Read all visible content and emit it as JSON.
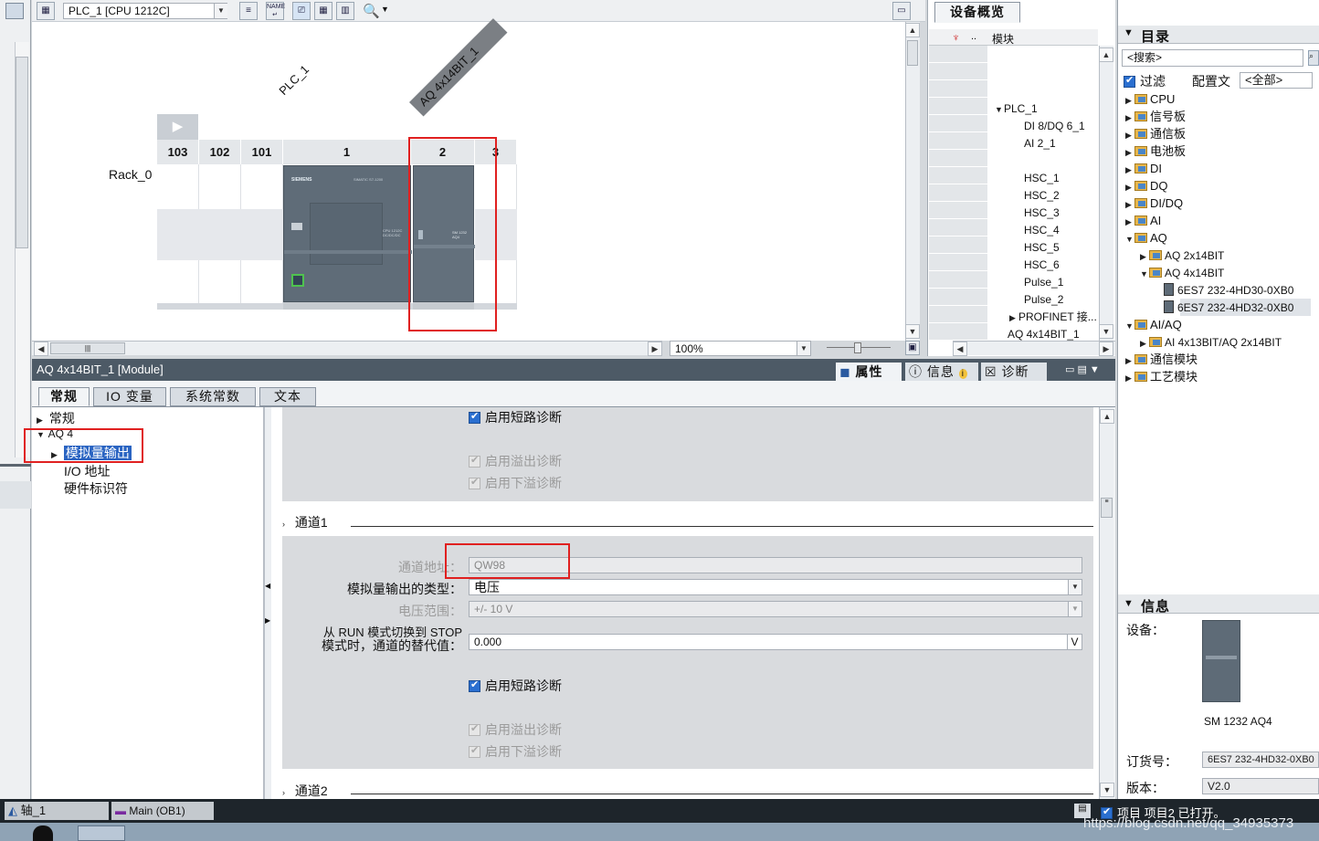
{
  "toolbar": {
    "device_select": "PLC_1 [CPU 1212C]",
    "zoom": "100%"
  },
  "canvas": {
    "plc_label": "PLC_1",
    "module_label": "AQ 4x14BIT_1",
    "rack_label": "Rack_0",
    "slots": [
      "103",
      "102",
      "101",
      "1",
      "2",
      "3"
    ],
    "cpu_brand": "SIEMENS",
    "cpu_model": "SIMATIC S7-1200",
    "cpu_text": "CPU 1212C DC/DC/DC",
    "module_text": "SM 1232 AQ4"
  },
  "overview": {
    "tab": "设备概览",
    "col_module": "模块",
    "rows": [
      "PLC_1",
      "DI 8/DQ 6_1",
      "AI 2_1",
      "HSC_1",
      "HSC_2",
      "HSC_3",
      "HSC_4",
      "HSC_5",
      "HSC_6",
      "Pulse_1",
      "Pulse_2",
      "PROFINET 接...",
      "AQ 4x14BIT_1"
    ]
  },
  "catalog": {
    "title": "目录",
    "search_placeholder": "<搜索>",
    "filter_label": "过滤",
    "config_label": "配置文",
    "config_value": "<全部>",
    "items": [
      {
        "label": "CPU",
        "level": 0,
        "expanded": false
      },
      {
        "label": "信号板",
        "level": 0,
        "expanded": false
      },
      {
        "label": "通信板",
        "level": 0,
        "expanded": false
      },
      {
        "label": "电池板",
        "level": 0,
        "expanded": false
      },
      {
        "label": "DI",
        "level": 0,
        "expanded": false
      },
      {
        "label": "DQ",
        "level": 0,
        "expanded": false
      },
      {
        "label": "DI/DQ",
        "level": 0,
        "expanded": false
      },
      {
        "label": "AI",
        "level": 0,
        "expanded": false
      },
      {
        "label": "AQ",
        "level": 0,
        "expanded": true
      },
      {
        "label": "AQ 2x14BIT",
        "level": 1,
        "expanded": false
      },
      {
        "label": "AQ 4x14BIT",
        "level": 1,
        "expanded": true
      },
      {
        "label": "6ES7 232-4HD30-0XB0",
        "level": 2,
        "expanded": false
      },
      {
        "label": "6ES7 232-4HD32-0XB0",
        "level": 2,
        "expanded": false
      },
      {
        "label": "AI/AQ",
        "level": 0,
        "expanded": true
      },
      {
        "label": "AI 4x13BIT/AQ 2x14BIT",
        "level": 1,
        "expanded": false
      },
      {
        "label": "通信模块",
        "level": 0,
        "expanded": false
      },
      {
        "label": "工艺模块",
        "level": 0,
        "expanded": false
      }
    ]
  },
  "info": {
    "title": "信息",
    "device_label": "设备：",
    "device_name": "SM 1232 AQ4",
    "order_label": "订货号：",
    "order_value": "6ES7 232-4HD32-0XB0",
    "version_label": "版本：",
    "version_value": "V2.0"
  },
  "properties": {
    "title": "AQ 4x14BIT_1 [Module]",
    "top_tabs": [
      "属性",
      "信息",
      "诊断"
    ],
    "tabs": [
      "常规",
      "IO 变量",
      "系统常数",
      "文本"
    ],
    "nav": [
      "常规",
      "AQ 4",
      "模拟量输出",
      "I/O 地址",
      "硬件标识符"
    ],
    "enable_short": "启用短路诊断",
    "enable_overflow": "启用溢出诊断",
    "enable_underflow": "启用下溢诊断",
    "channel1": "通道1",
    "channel2": "通道2",
    "addr_label": "通道地址：",
    "addr_value": "QW98",
    "type_label": "模拟量输出的类型：",
    "type_value": "电压",
    "range_label": "电压范围：",
    "range_value": "+/- 10 V",
    "subst_label_1": "从 RUN 模式切换到 STOP",
    "subst_label_2": "模式时，通道的替代值：",
    "subst_value": "0.000",
    "subst_unit": "V"
  },
  "statusbar": {
    "tab1": "轴_1",
    "tab2": "Main (OB1)",
    "message": "项目 项目2 已打开。",
    "watermark": "https://blog.csdn.net/qq_34935373"
  }
}
